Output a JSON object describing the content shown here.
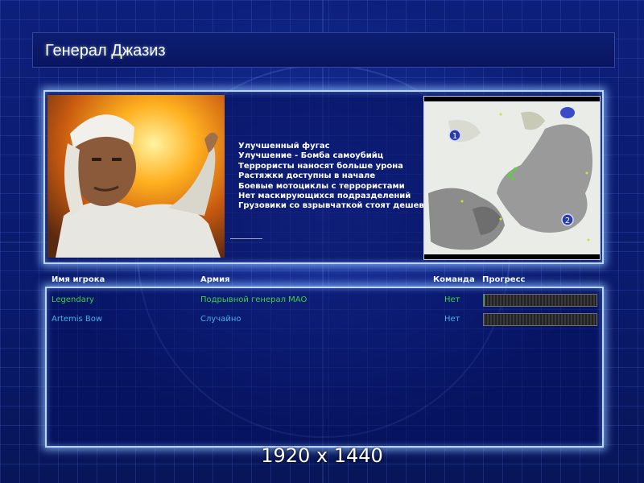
{
  "title": "Генерал Джазиз",
  "general": {
    "features": [
      "Улучшенный фугас",
      "Улучшение - Бомба самоубийц",
      "Террористы наносят больше урона",
      "Растяжки доступны в начале",
      "Боевые мотоциклы с террористами",
      "Нет маскирующихся подразделений",
      "Грузовики со взрывчаткой стоят дешевле"
    ]
  },
  "minimap": {
    "start_positions": [
      "1",
      "2"
    ]
  },
  "table": {
    "headers": {
      "player": "Имя игрока",
      "army": "Армия",
      "team": "Команда",
      "progress": "Прогресс"
    },
    "rows": [
      {
        "player": "Legendary",
        "army": "Подрывной генерал MAO",
        "team": "Нет",
        "progress": 0.01,
        "color": "#3cd23c"
      },
      {
        "player": "Artemis Bow",
        "army": "Случайно",
        "team": "Нет",
        "progress": 0.0,
        "color": "#3fb4e6"
      }
    ]
  },
  "resolution": "1920 x 1440",
  "colors": {
    "panel_glow": "#b9d4ff",
    "background": "#0a1a6a"
  }
}
